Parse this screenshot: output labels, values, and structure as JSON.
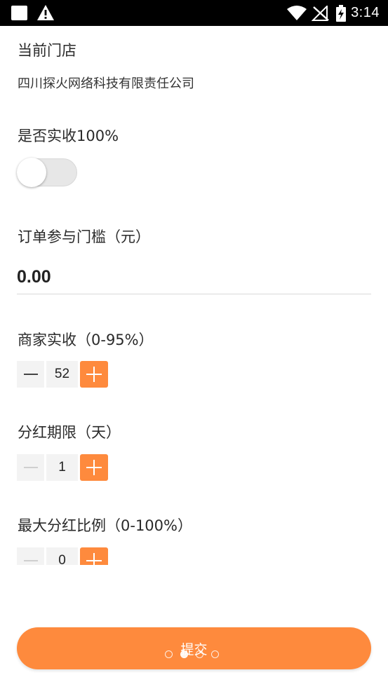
{
  "status_bar": {
    "time": "3:14",
    "icons": [
      "app-notification-icon",
      "warning-icon",
      "wifi-icon",
      "no-signal-icon",
      "battery-charging-icon"
    ]
  },
  "store": {
    "label": "当前门店",
    "name": "四川探火网络科技有限责任公司"
  },
  "full_receipt": {
    "label": "是否实收100%",
    "enabled": false
  },
  "threshold": {
    "label": "订单参与门槛（元）",
    "value": "0.00"
  },
  "merchant_ratio": {
    "label": "商家实收（0-95%）",
    "value": "52",
    "minus_disabled": false
  },
  "dividend_period": {
    "label": "分红期限（天）",
    "value": "1",
    "minus_disabled": true
  },
  "max_dividend": {
    "label": "最大分红比例（0-100%）",
    "value": "0",
    "minus_disabled": true
  },
  "submit": {
    "label": "提交"
  },
  "page_indicator": {
    "count": 4,
    "active": 1
  },
  "colors": {
    "accent": "#fe8a3d",
    "status_bar": "#000000",
    "stepper_bg": "#f3f3f3",
    "divider": "#d9d9d9"
  }
}
